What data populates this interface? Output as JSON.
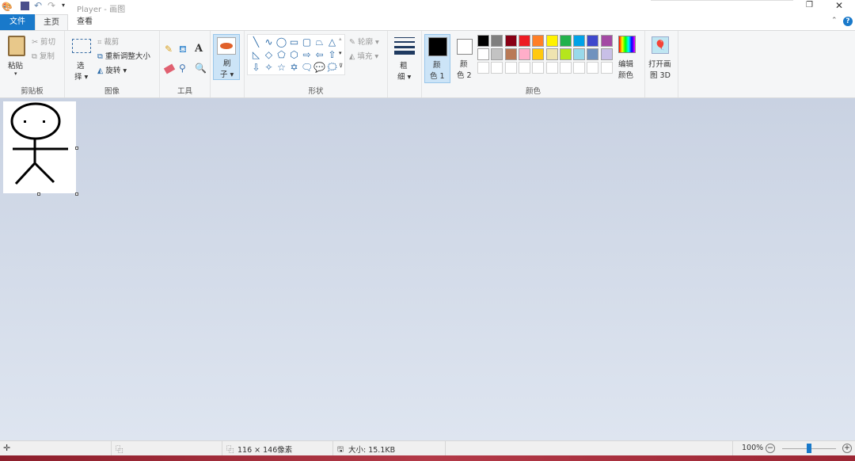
{
  "window": {
    "title": "Player - 画图"
  },
  "tabs": [
    {
      "label": "文件"
    },
    {
      "label": "主页"
    },
    {
      "label": "查看"
    }
  ],
  "clipboard": {
    "paste": "粘贴",
    "cut": "剪切",
    "copy": "复制",
    "label": "剪贴板"
  },
  "image": {
    "select_1": "选",
    "select_2": "择",
    "crop": "裁剪",
    "resize": "重新调整大小",
    "rotate": "旋转",
    "label": "图像"
  },
  "tools": {
    "label": "工具",
    "brush_1": "刷",
    "brush_2": "子"
  },
  "shapes": {
    "outline": "轮廓",
    "fill": "填充",
    "label": "形状",
    "items": [
      "╲",
      "∿",
      "◯",
      "▭",
      "▢",
      "⏢",
      "△",
      "◺",
      "◇",
      "⬠",
      "⬡",
      "⇨",
      "⇦",
      "⇧",
      "⇩",
      "✧",
      "☆",
      "✡",
      "🗨",
      "💬",
      "🗯"
    ]
  },
  "size": {
    "l1": "粗",
    "l2": "细"
  },
  "colors": {
    "color1_1": "颜",
    "color1_2": "色 1",
    "color2_1": "颜",
    "color2_2": "色 2",
    "edit_1": "编辑",
    "edit_2": "颜色",
    "label": "颜色",
    "color1": "#000000",
    "color2": "#ffffff",
    "palette_row1": [
      "#000000",
      "#7f7f7f",
      "#880015",
      "#ed1c24",
      "#ff7f27",
      "#fff200",
      "#22b14c",
      "#00a2e8",
      "#3f48cc",
      "#a349a4"
    ],
    "palette_row2": [
      "#ffffff",
      "#c3c3c3",
      "#b97a57",
      "#ffaec9",
      "#ffc90e",
      "#efe4b0",
      "#b5e61d",
      "#99d9ea",
      "#7092be",
      "#c8bfe7"
    ]
  },
  "paint3d": {
    "l1": "打开画",
    "l2": "图 3D"
  },
  "status": {
    "dimensions": "116 × 146像素",
    "size": "大小: 15.1KB",
    "zoom": "100%",
    "zoom_percent": 100
  }
}
